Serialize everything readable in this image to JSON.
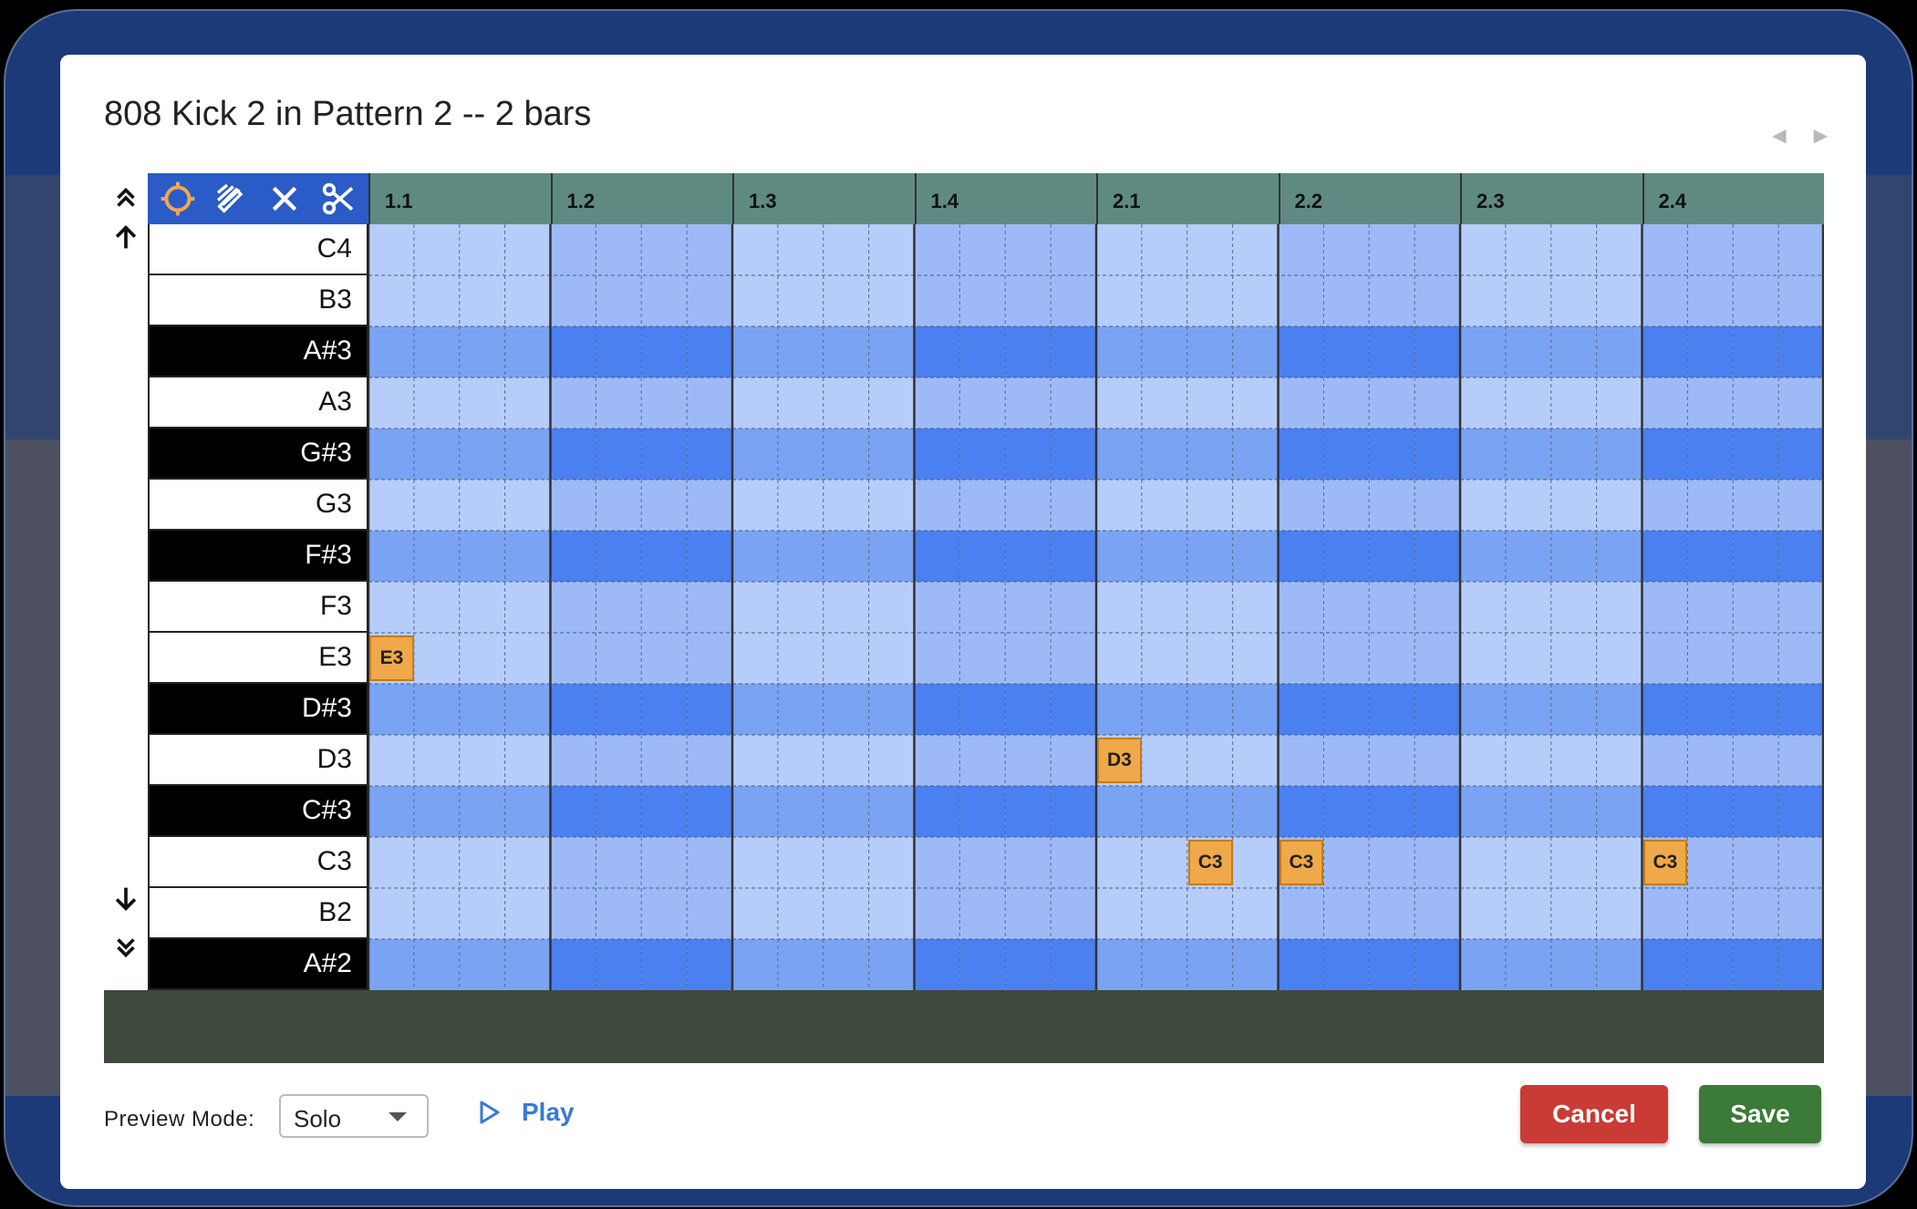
{
  "dialog": {
    "title": "808 Kick 2 in Pattern 2 -- 2 bars",
    "nav_prev": "◀",
    "nav_next": "▶"
  },
  "toolbar": {
    "tools": [
      "select-tool",
      "draw-tool",
      "erase-tool",
      "cut-tool"
    ],
    "colors": {
      "bar": "#2a5bc7",
      "active_tool": "#f0a94a",
      "icon": "#ffffff"
    }
  },
  "side_controls": [
    "page-up",
    "scroll-up",
    "scroll-down",
    "page-down"
  ],
  "timeline": {
    "beats": [
      "1.1",
      "1.2",
      "1.3",
      "1.4",
      "2.1",
      "2.2",
      "2.3",
      "2.4"
    ],
    "steps_per_beat": 4
  },
  "keys": [
    {
      "label": "C4",
      "black": false
    },
    {
      "label": "B3",
      "black": false
    },
    {
      "label": "A#3",
      "black": true
    },
    {
      "label": "A3",
      "black": false
    },
    {
      "label": "G#3",
      "black": true
    },
    {
      "label": "G3",
      "black": false
    },
    {
      "label": "F#3",
      "black": true
    },
    {
      "label": "F3",
      "black": false
    },
    {
      "label": "E3",
      "black": false
    },
    {
      "label": "D#3",
      "black": true
    },
    {
      "label": "D3",
      "black": false
    },
    {
      "label": "C#3",
      "black": true
    },
    {
      "label": "C3",
      "black": false
    },
    {
      "label": "B2",
      "black": false
    },
    {
      "label": "A#2",
      "black": true
    }
  ],
  "notes": [
    {
      "pitch": "E3",
      "step": 0,
      "label": "E3"
    },
    {
      "pitch": "D3",
      "step": 16,
      "label": "D3"
    },
    {
      "pitch": "C3",
      "step": 18,
      "label": "C3"
    },
    {
      "pitch": "C3",
      "step": 20,
      "label": "C3"
    },
    {
      "pitch": "C3",
      "step": 28,
      "label": "C3"
    }
  ],
  "grid_colors": {
    "white_light": "#b6cdfa",
    "white_dark": "#9dbaf7",
    "black_light": "#7ba3f3",
    "black_dark": "#4a80f0"
  },
  "preview": {
    "label": "Preview Mode:",
    "value": "Solo",
    "play_label": "Play"
  },
  "buttons": {
    "cancel": "Cancel",
    "save": "Save"
  }
}
